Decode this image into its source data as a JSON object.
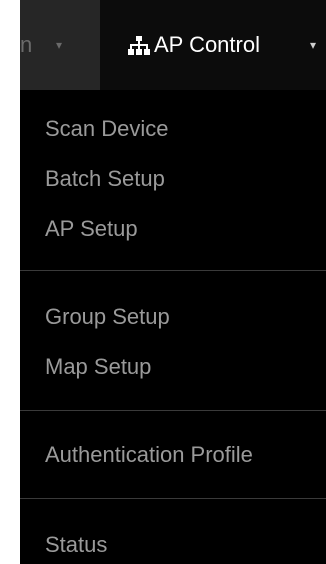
{
  "navbar": {
    "prev_menu": {
      "label": "n",
      "caret": "▾"
    },
    "active_menu": {
      "icon": "sitemap-icon",
      "label": "AP Control",
      "caret": "▾"
    }
  },
  "dropdown": {
    "items": [
      {
        "label": "Scan Device"
      },
      {
        "label": "Batch Setup"
      },
      {
        "label": "AP Setup"
      },
      {
        "label": "Group Setup"
      },
      {
        "label": "Map Setup"
      },
      {
        "label": "Authentication Profile"
      },
      {
        "label": "Status"
      }
    ]
  },
  "colors": {
    "navbar_bg": "#222222",
    "active_bg": "#0c0c0c",
    "dropdown_bg": "#000000",
    "item_text": "#9a9a9a",
    "divider": "#3a3a3a"
  }
}
